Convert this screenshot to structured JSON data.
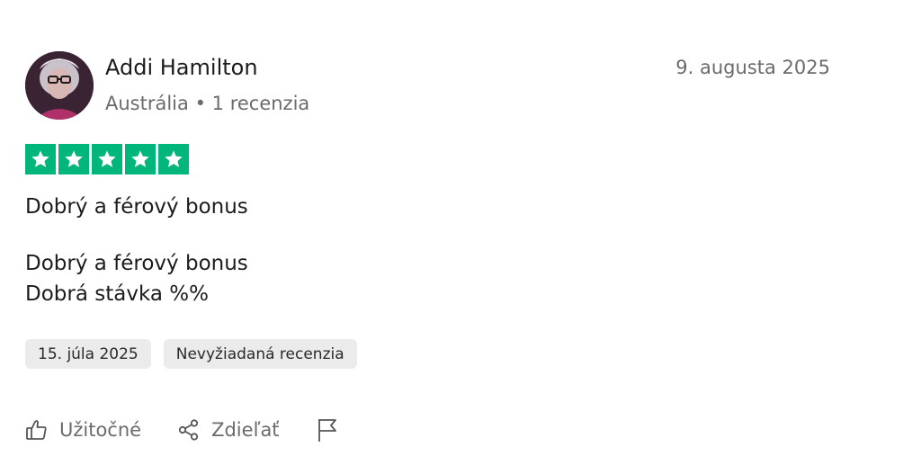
{
  "reviewer": {
    "name": "Addi Hamilton",
    "country": "Austrália",
    "separator": "•",
    "review_count": "1 recenzia"
  },
  "review": {
    "date": "9. augusta 2025",
    "rating": 5,
    "title": "Dobrý a férový bonus",
    "body_lines": [
      "Dobrý a férový bonus",
      "Dobrá stávka %%"
    ],
    "experience_date": "15. júla 2025",
    "source_tag": "Nevyžiadaná recenzia"
  },
  "actions": {
    "like_label": "Užitočné",
    "share_label": "Zdieľať",
    "report_icon": "flag-icon",
    "like_icon": "thumbs-up-icon",
    "share_icon": "share-icon"
  },
  "colors": {
    "star_bg": "#00b67a",
    "tag_bg": "#ebebeb",
    "muted_text": "#6b6b6b"
  }
}
